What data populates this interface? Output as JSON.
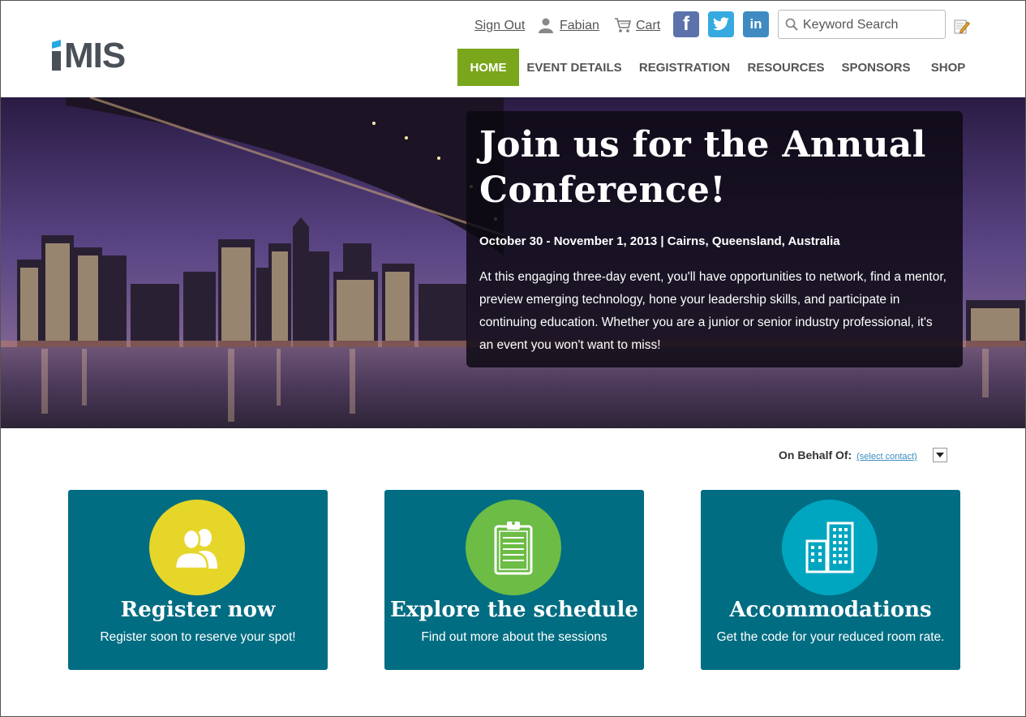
{
  "header": {
    "logo_text": "iMIS",
    "sign_out": "Sign Out",
    "user_name": "Fabian",
    "cart": "Cart",
    "search_placeholder": "Keyword Search",
    "social": {
      "facebook": "f",
      "linkedin": "in"
    }
  },
  "nav": {
    "items": [
      {
        "label": "HOME",
        "active": true
      },
      {
        "label": "EVENT DETAILS"
      },
      {
        "label": "REGISTRATION"
      },
      {
        "label": "RESOURCES"
      },
      {
        "label": "SPONSORS"
      },
      {
        "label": "SHOP"
      }
    ]
  },
  "hero": {
    "title": "Join us for the Annual Conference!",
    "meta": "October 30 - November 1, 2013 | Cairns, Queensland, Australia",
    "description": "At this engaging three-day event, you'll have opportunities to network, find a mentor, preview emerging technology, hone your leadership skills, and participate in continuing education. Whether you are a junior or senior industry professional, it's an event you won't want to miss!"
  },
  "behalf": {
    "label": "On Behalf Of:",
    "link": "(select contact)"
  },
  "cards": [
    {
      "title": "Register now",
      "subtitle": "Register soon to reserve your spot!",
      "icon": "users-icon",
      "color": "#e6d62a"
    },
    {
      "title": "Explore the schedule",
      "subtitle": "Find out more about the sessions",
      "icon": "clipboard-icon",
      "color": "#6cbc45"
    },
    {
      "title": "Accommodations",
      "subtitle": "Get the code for your reduced room rate.",
      "icon": "buildings-icon",
      "color": "#00a6c0"
    }
  ],
  "colors": {
    "nav_active": "#7aa61b",
    "card_bg": "#006d82",
    "logo_accent": "#27a9e1",
    "logo_text": "#4a5058"
  }
}
